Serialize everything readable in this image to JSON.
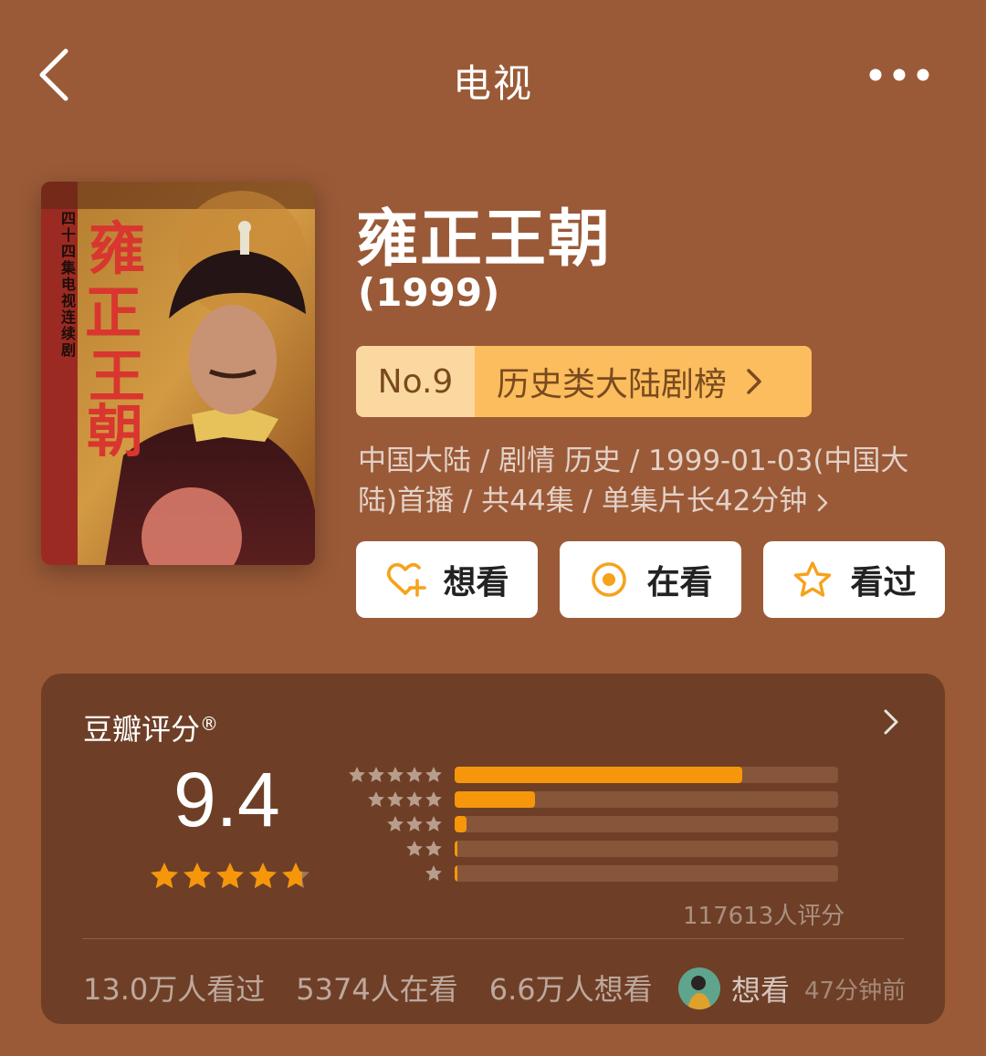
{
  "header": {
    "title": "电视",
    "back_icon": "chevron-left-icon",
    "more_icon": "more-dots-icon"
  },
  "poster": {
    "vertical_caption": "四十四集电视连续剧",
    "calligraphy": "雍正王朝"
  },
  "show": {
    "title": "雍正王朝",
    "year": "(1999)",
    "rank": {
      "number": "No.9",
      "list_name": "历史类大陆剧榜"
    },
    "meta": "中国大陆 / 剧情 历史 / 1999-01-03(中国大陆)首播 / 共44集 / 单集片长42分钟"
  },
  "actions": {
    "want": {
      "label": "想看",
      "icon": "heart-plus-icon"
    },
    "doing": {
      "label": "在看",
      "icon": "target-circle-icon"
    },
    "done": {
      "label": "看过",
      "icon": "star-outline-icon"
    }
  },
  "rating": {
    "title": "豆瓣评分",
    "trademark": "®",
    "score": "9.4",
    "star_value": 4.7,
    "distribution": [
      {
        "stars": 5,
        "fraction": 0.75
      },
      {
        "stars": 4,
        "fraction": 0.21
      },
      {
        "stars": 3,
        "fraction": 0.03
      },
      {
        "stars": 2,
        "fraction": 0.004
      },
      {
        "stars": 1,
        "fraction": 0.004
      }
    ],
    "count": "117613人评分"
  },
  "stats": {
    "watched": "13.0万人看过",
    "watching": "5374人在看",
    "wish": "6.6万人想看"
  },
  "friend": {
    "action": "想看",
    "time": "47分钟前"
  },
  "colors": {
    "background": "#9a5a37",
    "card": "#6e3f26",
    "accent_orange": "#f6970b",
    "rank_light": "#fcd8a1",
    "rank_dark": "#fbbd5d"
  }
}
